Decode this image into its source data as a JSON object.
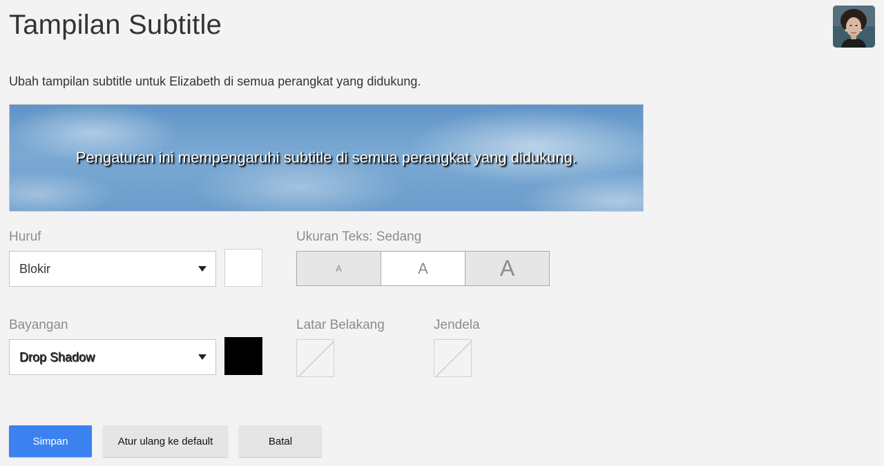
{
  "header": {
    "title": "Tampilan Subtitle",
    "avatar_icon": "profile-avatar"
  },
  "description": "Ubah tampilan subtitle untuk Elizabeth di semua perangkat yang didukung.",
  "preview": {
    "text": "Pengaturan ini mempengaruhi subtitle di semua perangkat yang didukung."
  },
  "font": {
    "label": "Huruf",
    "selected": "Blokir",
    "color": "#ffffff"
  },
  "text_size": {
    "label": "Ukuran Teks: Sedang",
    "options": [
      "A",
      "A",
      "A"
    ],
    "selected_index": 1
  },
  "shadow": {
    "label": "Bayangan",
    "selected": "Drop Shadow",
    "color": "#000000"
  },
  "background": {
    "label": "Latar Belakang",
    "value": "none"
  },
  "window": {
    "label": "Jendela",
    "value": "none"
  },
  "buttons": {
    "save": "Simpan",
    "reset": "Atur ulang ke default",
    "cancel": "Batal"
  },
  "colors": {
    "primary": "#3b82f0",
    "page_background": "#f3f3f3"
  }
}
